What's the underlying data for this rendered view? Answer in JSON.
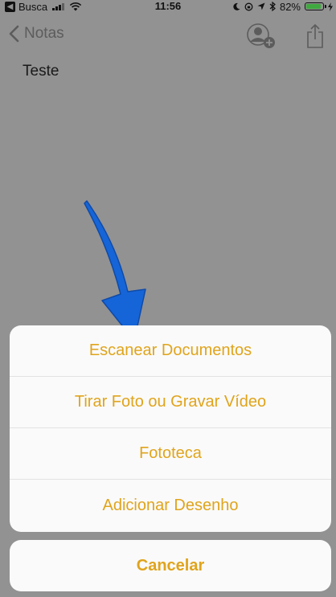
{
  "status_bar": {
    "back_app": "Busca",
    "time": "11:56",
    "battery": "82%",
    "battery_level": 0.82,
    "battery_color": "#3fa83f"
  },
  "nav": {
    "back_label": "Notas"
  },
  "note": {
    "title": "Teste"
  },
  "action_sheet": {
    "items": [
      {
        "label": "Escanear Documentos"
      },
      {
        "label": "Tirar Foto ou Gravar Vídeo"
      },
      {
        "label": "Fototeca"
      },
      {
        "label": "Adicionar Desenho"
      }
    ],
    "cancel_label": "Cancelar",
    "accent_color": "#e0a41c"
  },
  "annotation": {
    "icon": "blue-arrow-pointing-down",
    "color": "#1565d8"
  }
}
